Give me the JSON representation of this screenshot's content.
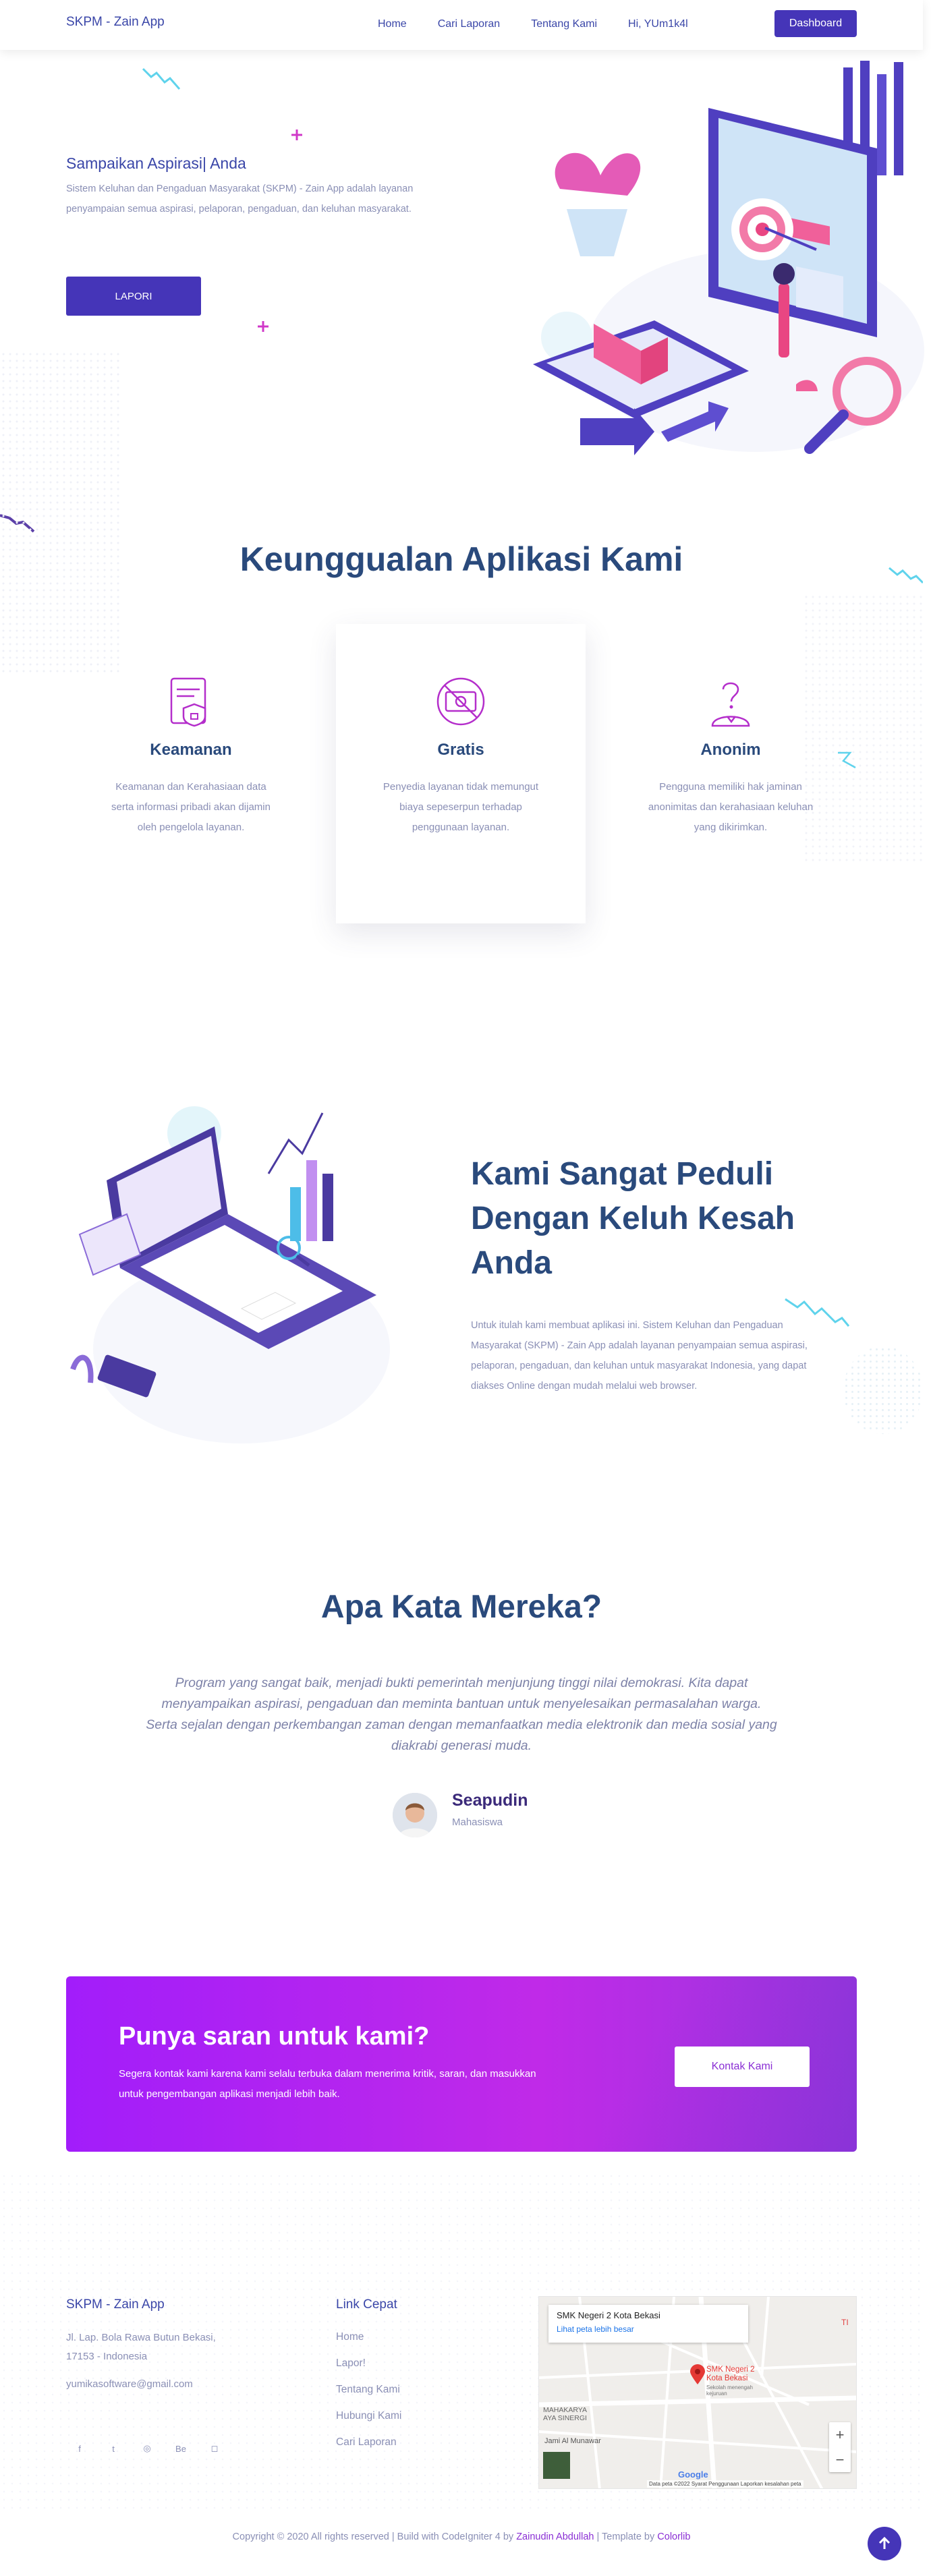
{
  "nav": {
    "brand": "SKPM - Zain App",
    "links": [
      "Home",
      "Cari Laporan",
      "Tentang Kami",
      "Hi, YUm1k4l"
    ],
    "dashboard": "Dashboard"
  },
  "hero": {
    "title": "Sampaikan Aspirasi| Anda",
    "description": "Sistem Keluhan dan Pengaduan Masyarakat (SKPM) - Zain App adalah layanan penyampaian semua aspirasi, pelaporan, pengaduan, dan keluhan masyarakat.",
    "button": "LAPORI"
  },
  "features": {
    "title": "Keunggualan Aplikasi Kami",
    "items": [
      {
        "icon": "shield-document-icon",
        "title": "Keamanan",
        "text": "Keamanan dan Kerahasiaan data serta informasi pribadi akan dijamin oleh pengelola layanan."
      },
      {
        "icon": "free-no-money-icon",
        "title": "Gratis",
        "text": "Penyedia layanan tidak memungut biaya sepeserpun terhadap penggunaan layanan."
      },
      {
        "icon": "anonymous-user-icon",
        "title": "Anonim",
        "text": "Pengguna memiliki hak jaminan anonimitas dan kerahasiaan keluhan yang dikirimkan."
      }
    ]
  },
  "peduli": {
    "title": "Kami Sangat Peduli Dengan Keluh Kesah Anda",
    "description": "Untuk itulah kami membuat aplikasi ini. Sistem Keluhan dan Pengaduan Masyarakat (SKPM) - Zain App adalah layanan penyampaian semua aspirasi, pelaporan, pengaduan, dan keluhan untuk masyarakat Indonesia, yang dapat diakses Online dengan mudah melalui web browser."
  },
  "testimonial": {
    "title": "Apa Kata Mereka?",
    "quote": "Program yang sangat baik, menjadi bukti pemerintah menjunjung tinggi nilai demokrasi. Kita dapat menyampaikan aspirasi, pengaduan dan meminta bantuan untuk menyelesaikan permasalahan warga. Serta sejalan dengan perkembangan zaman dengan memanfaatkan media elektronik dan media sosial yang diakrabi generasi muda.",
    "name": "Seapudin",
    "role": "Mahasiswa"
  },
  "cta": {
    "title": "Punya saran untuk kami?",
    "text": "Segera kontak kami karena kami selalu terbuka dalam menerima kritik, saran, dan masukkan untuk pengembangan aplikasi menjadi lebih baik.",
    "button": "Kontak Kami"
  },
  "footer": {
    "brand": "SKPM - Zain App",
    "address": "Jl. Lap. Bola Rawa Butun Bekasi, 17153 - Indonesia",
    "email": "yumikasoftware@gmail.com",
    "socials": [
      "f",
      "t",
      "◎",
      "Be",
      "◻"
    ],
    "links_title": "Link Cepat",
    "links": [
      "Home",
      "Lapor!",
      "Tentang Kami",
      "Hubungi Kami",
      "Cari Laporan"
    ],
    "map": {
      "place": "SMK Negeri 2 Kota Bekasi",
      "link": "Lihat peta lebih besar",
      "pin_label": "SMK Negeri 2 Kota Bekasi",
      "pin_sub": "Sekolah menengah kejuruan",
      "area1": "MAHAKARYA",
      "area2": "AYA SINERGI",
      "area3": "Jami Al Munawar",
      "credits": "Data peta ©2022   Syarat Penggunaan   Laporkan kesalahan peta",
      "google": "Google"
    },
    "copyright_pre": "Copyright © 2020 All rights reserved | Build with CodeIgniter 4 by ",
    "author": "Zainudin Abdullah",
    "copyright_mid": " | Template by ",
    "template": "Colorlib"
  },
  "colors": {
    "primary": "#4535b8",
    "heading": "#2a4a7c",
    "accent": "#c02ae8",
    "muted": "#8a8fb5"
  }
}
